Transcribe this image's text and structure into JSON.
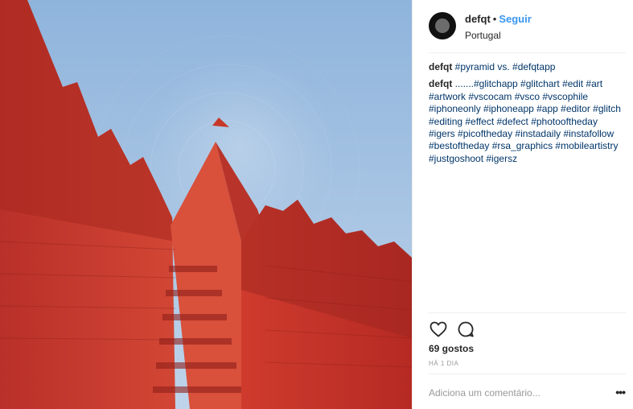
{
  "post": {
    "username": "defqt",
    "follow_label": "Seguir",
    "separator": "•",
    "location": "Portugal",
    "caption_user": "defqt",
    "caption_text": "#pyramid vs. #defqtapp",
    "comment_user": "defqt",
    "comment_text": ".......#glitchapp #glitchart #edit #art #artwork #vscocam #vsco #vscophile #iphoneonly #iphoneapp #app #editor #glitch #editing #effect #defect #photooftheday #igers #picoftheday #instadaily #instafollow #bestoftheday #rsa_graphics #mobileartistry #justgoshoot #igersz",
    "likes": "69 gostos",
    "time": "HÁ 1 DIA",
    "add_comment_placeholder": "Adiciona um comentário...",
    "more_label": "•••"
  },
  "icons": {
    "like": "heart-icon",
    "comment": "comment-bubble-icon",
    "more": "more-options-icon"
  },
  "colors": {
    "follow": "#3897f0",
    "hashtag": "#003569",
    "sky": "#9fbfe0",
    "wall": "#c8362a"
  }
}
